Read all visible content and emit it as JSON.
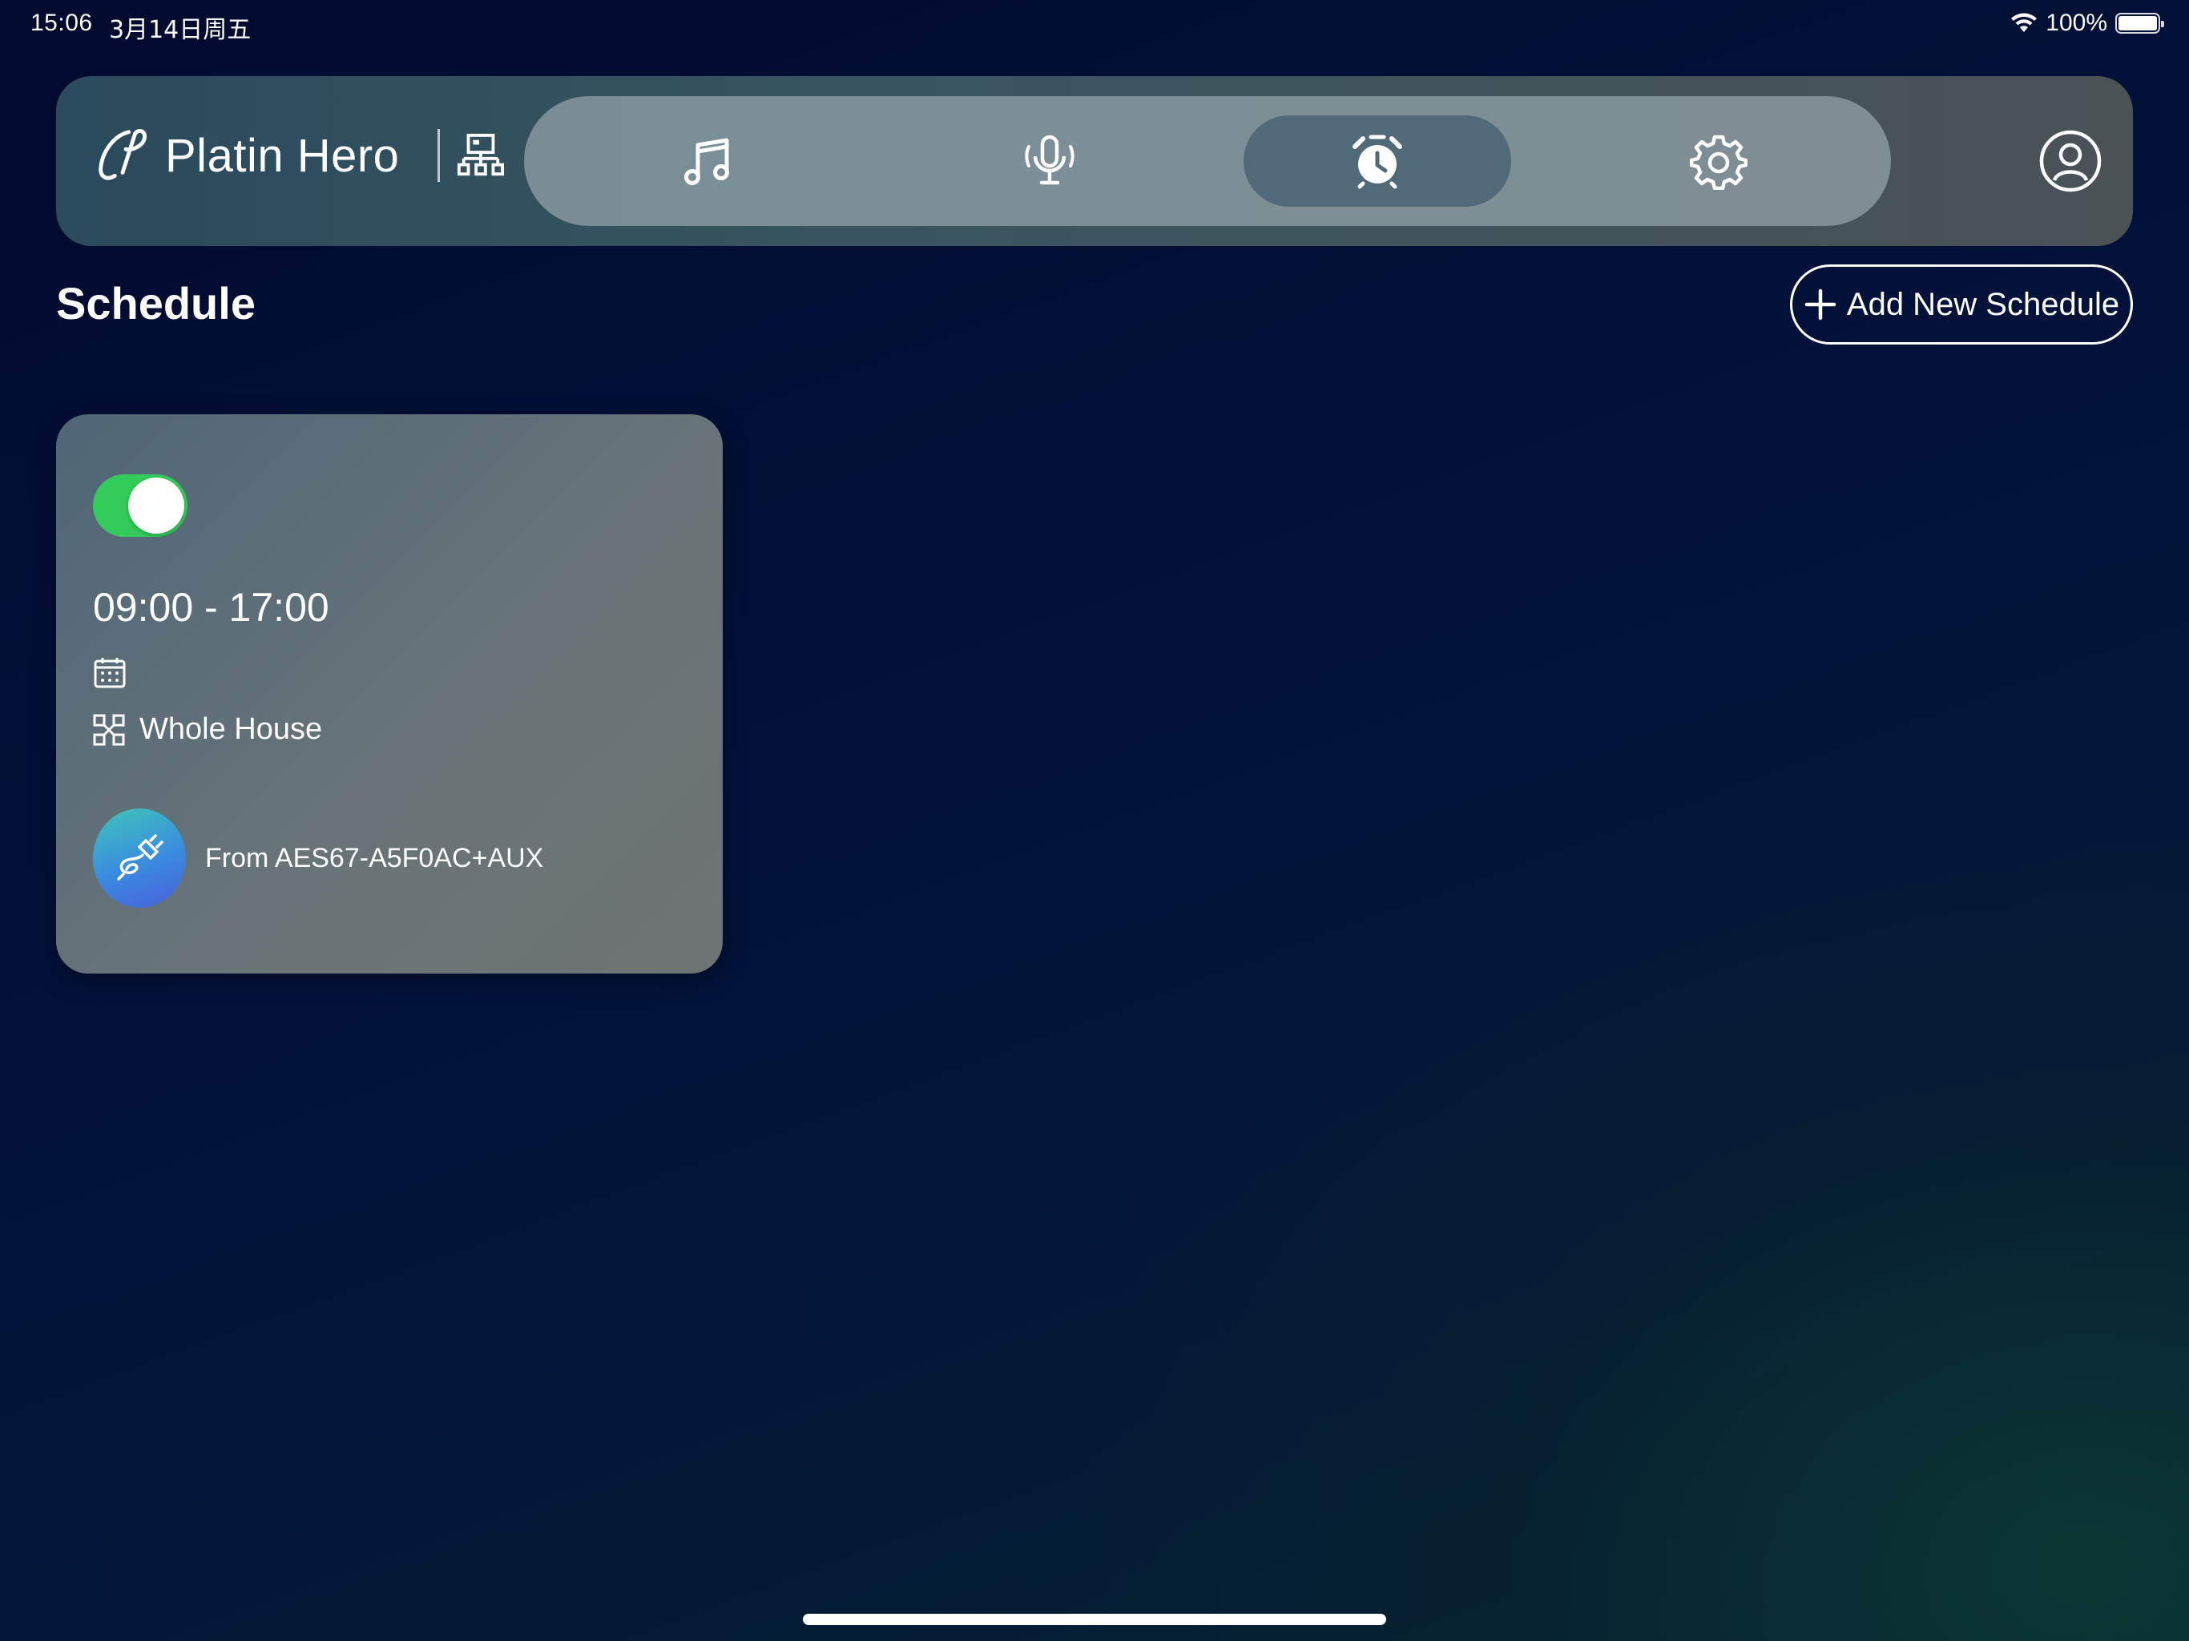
{
  "status_bar": {
    "time": "15:06",
    "date": "3月14日周五",
    "battery_text": "100%",
    "battery_level": 1.0
  },
  "app": {
    "name": "Platin Hero"
  },
  "nav": {
    "items": [
      {
        "icon": "music-note-icon",
        "active": false
      },
      {
        "icon": "microphone-icon",
        "active": false
      },
      {
        "icon": "alarm-clock-icon",
        "active": true
      },
      {
        "icon": "gear-icon",
        "active": false
      }
    ]
  },
  "page": {
    "title": "Schedule",
    "add_button_label": "Add New Schedule"
  },
  "schedules": [
    {
      "enabled": true,
      "time_range": "09:00 - 17:00",
      "zone": "Whole House",
      "source": "From AES67-A5F0AC+AUX"
    }
  ],
  "colors": {
    "toggle_on": "#33cc5a",
    "active_tab": "#506a79",
    "nav_pill": "#96a5ac"
  }
}
